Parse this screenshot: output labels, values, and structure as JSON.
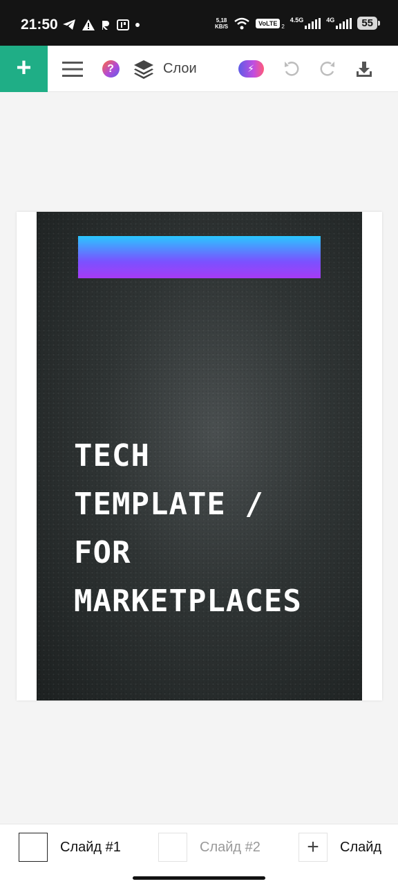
{
  "status_bar": {
    "time": "21:50",
    "speed_top": "5,18",
    "speed_bottom": "KB/S",
    "volte": "VoLTE",
    "volte_sub": "2",
    "net1": "4.5G",
    "net2": "4G",
    "battery": "55"
  },
  "toolbar": {
    "add_symbol": "+",
    "help_symbol": "?",
    "layers_label": "Слои",
    "ai_symbol": "⚡"
  },
  "slide": {
    "title": "TECH\nTEMPLATE /\nFOR\nMARKETPLACES",
    "gradient_bar_colors": [
      "#2ac7ff",
      "#a63bf5"
    ]
  },
  "slides_strip": {
    "tabs": [
      {
        "label": "Слайд #1",
        "active": true
      },
      {
        "label": "Слайд #2",
        "active": false
      }
    ],
    "add_symbol": "+",
    "add_label": "Слайд"
  },
  "colors": {
    "accent": "#1fae86",
    "slide_background": "#2f3434"
  }
}
